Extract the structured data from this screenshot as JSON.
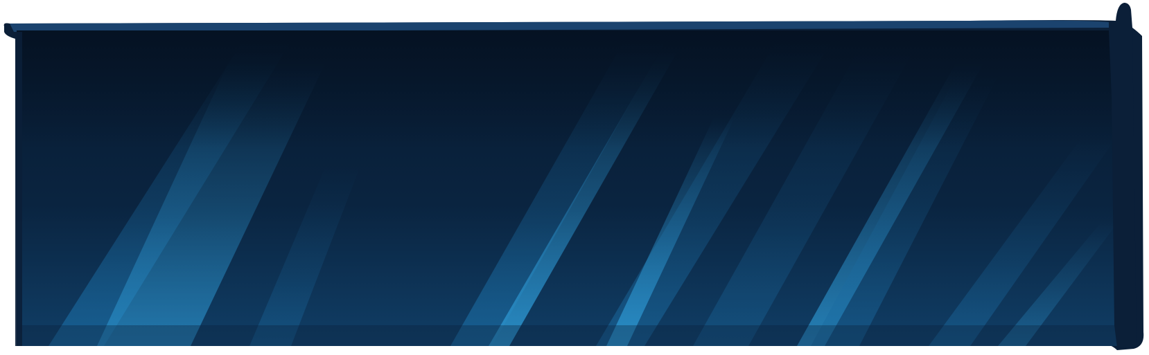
{
  "panel": {
    "kind": "decorative-banner-panel",
    "text": "",
    "colors": {
      "frame": "#0b1f38",
      "top_edge": "#1f4a78",
      "background_top": "#071a30",
      "background_bottom": "#103e66",
      "streak_light": "#2a8fc8",
      "streak_mid": "#1a6aa0",
      "streak_dark": "#0d3358"
    }
  }
}
